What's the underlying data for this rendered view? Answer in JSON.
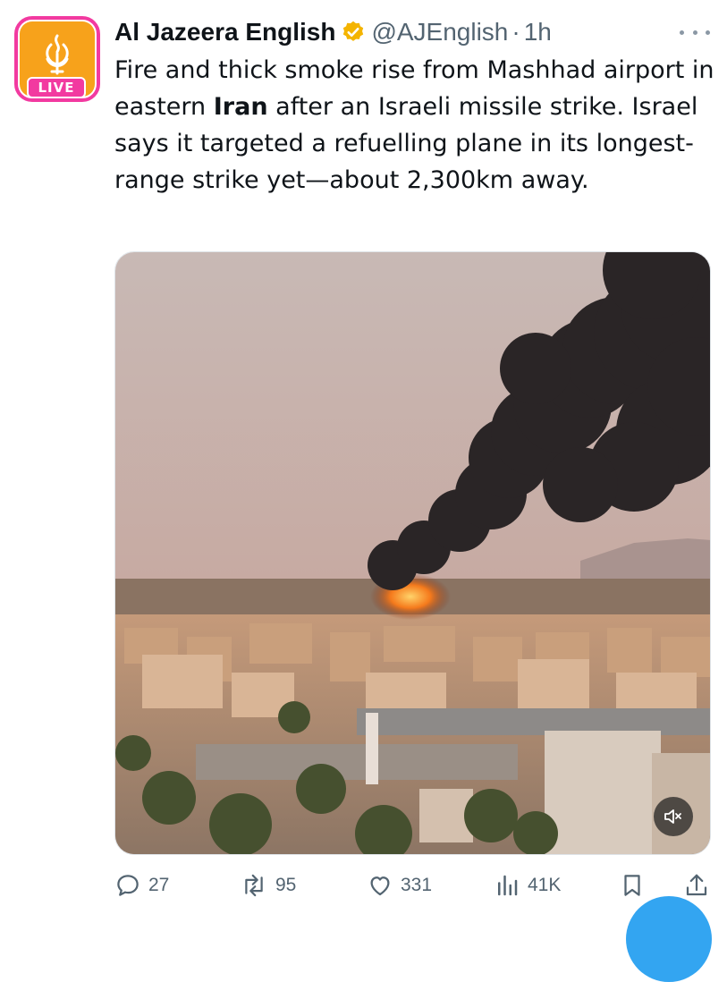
{
  "account": {
    "name": "Al Jazeera English",
    "handle": "@AJEnglish",
    "separator": "·",
    "time": "1h",
    "live_badge": "LIVE",
    "verified_color": "#f4b400",
    "live_color": "#f23aa0",
    "avatar_color": "#f7a21b"
  },
  "tweet": {
    "text_before": "Fire and thick smoke rise from Mashhad airport in eastern ",
    "text_bold": "Iran",
    "text_after": " after an Israeli missile strike. Israel says it targeted a refuelling plane in its longest-range strike yet—about 2,300km away."
  },
  "media": {
    "type": "video",
    "icons": [
      "mute-icon"
    ]
  },
  "actions": {
    "replies": "27",
    "reposts": "95",
    "likes": "331",
    "views": "41K",
    "icons": [
      "reply-icon",
      "repost-icon",
      "like-icon",
      "views-icon",
      "bookmark-icon",
      "share-icon"
    ]
  },
  "colors": {
    "text": "#0f1419",
    "secondary": "#536471",
    "accent": "#1d9bf0"
  }
}
